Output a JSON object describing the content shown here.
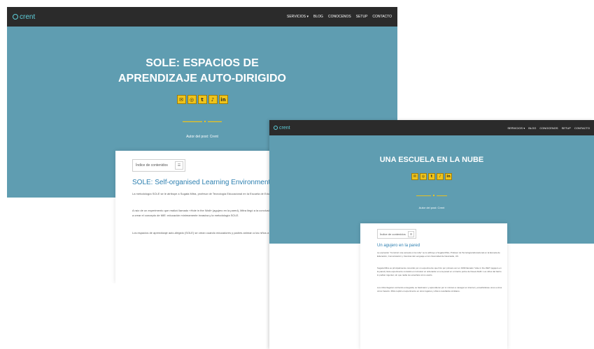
{
  "nav": {
    "logo": "crent",
    "menu": [
      "SERVICIOS ▾",
      "BLOG",
      "CONOCENOS",
      "SETUP",
      "CONTACTO"
    ]
  },
  "shot_a": {
    "title": "SOLE: ESPACIOS DE APRENDIZAJE AUTO-DIRIGIDO",
    "icons": [
      "email-icon",
      "instagram-icon",
      "twitter-icon",
      "tiktok-icon",
      "linkedin-icon"
    ],
    "author": "Autor del post: Crent",
    "toc": "Índice de contenidos",
    "heading": "SOLE: Self-organised Learning Environment",
    "para1": "La metodología SOLE se le atribuye a Sugata Mitra, profesor de Tecnología Educacional en la Escuela de Educación, Comunicación y Ciencias del Lenguaje en la Universidad de Newcastle, UK.",
    "para2": "A raíz de un experimento que realizó llamado «Hole in the Wall» (agujero en la pared), Mitra llegó a la conclusión de que los niños eran capaces de aprender casi cualquier cosa por sí mismos. Esto lo motivó a crear el concepto de MIE: educación mínimamente invasiva y la metodología SOLE.",
    "para3": "Los espacios de aprendizaje auto-dirigido (SOLE) se crean cuando educadores y padres animan a los niños a trabajar como comunidad para responder a sus propias preguntas a través de internet."
  },
  "shot_b": {
    "title": "UNA ESCUELA EN LA NUBE",
    "author": "Autor del post: Crent",
    "toc": "Índice de contenidos",
    "heading": "Un agujero en la pared",
    "para1": "La expresión \"Construir una escuela en la nube\" se le atribuye a Sugata Mitra, Profesor de Tecnología Educacional en la Escuela de Educación, Comunicación y Ciencias del Lenguaje en la Universidad de Newcastle, UK.",
    "para2": "Sugata Mitra es principalmente conocido por un experimento que hizo por primera vez en 1999 llamado \"Hole in the Wall\" (agujero en la pared). Este experimento consistió en incrustar un ordenador en una pared en un barrio pobre de Nueva Delhi. Los niños del barrio lo podían ingeniar, sin que nadie les enseñara cómo usarlo.",
    "para3": "Los niños llegaron corriendo enseguida, se fascinaron y aprendieron por sí mismos a navegar en internet y enseñándose unos a otros cómo hacerlo. Mitra repitió el experimento en otros lugares y obtuvo resultados similares."
  },
  "colors": {
    "nav_bg": "#2b2b2b",
    "hero_bg": "#5f9db1",
    "accent": "#f0c419",
    "heading": "#2c7fb0",
    "logo": "#5fd0dc"
  }
}
